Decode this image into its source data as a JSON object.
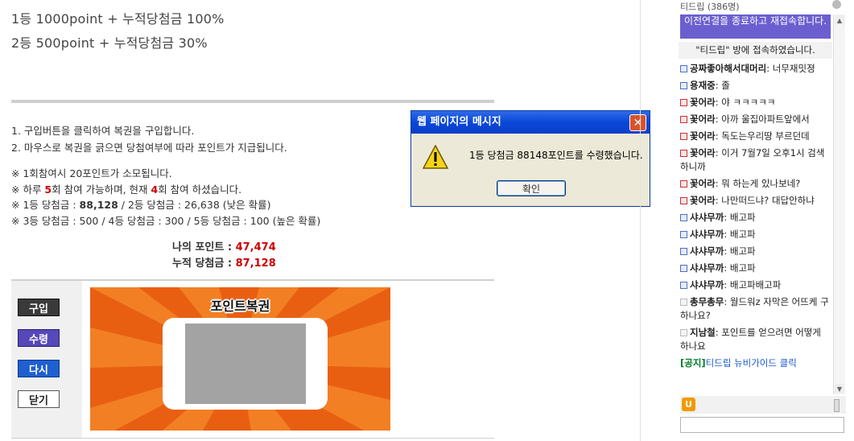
{
  "prizes": {
    "first": "1등  1000point + 누적당첨금 100%",
    "second": "2등  500point + 누적당첨금 30%"
  },
  "instructions": [
    "1. 구입버튼을 클릭하여 복권을 구입합니다.",
    "2. 마우스로 복권을 긁으면 당첨여부에 따라 포인트가 지급됩니다."
  ],
  "rules": {
    "cost": "※ 1회참여시 20포인트가 소모됩니다.",
    "limit_pre": "※ 하루 ",
    "limit_count": "5",
    "limit_mid": "회 참여 가능하며, 현재 ",
    "limit_current": "4",
    "limit_post": "회 참여 하셨습니다.",
    "r1_label": "※ 1등 당첨금 : ",
    "r1_value": "88,128",
    "r1_rest": " / 2등 당첨금 : 26,638 (낮은 확률)",
    "r2": "※ 3등 당첨금 : 500 / 4등 당첨금 : 300 / 5등 당첨금 : 100 (높은 확률)"
  },
  "points": {
    "my_label": "나의 포인트 : ",
    "my_value": "47,474",
    "acc_label": "누적 당첨금 : ",
    "acc_value": "87,128"
  },
  "buttons": {
    "buy": "구입",
    "receive": "수령",
    "again": "다시",
    "close": "닫기"
  },
  "lottery": {
    "title": "포인트복권"
  },
  "dialog": {
    "title": "웹 페이지의 메시지",
    "message": "1등 당첨금 88148포인트를 수령했습니다.",
    "ok": "확인",
    "icon": "warning-icon"
  },
  "chat": {
    "header": "티드립 (386명)",
    "reconnect": "이전연결을 종료하고 재접속합니다.",
    "system": "\"티드립\" 방에 접속하였습니다.",
    "messages": [
      {
        "nick": "공짜좋아해서대머리",
        "text": ": 너무재밋졍",
        "icon": "blue"
      },
      {
        "nick": "용재중",
        "text": ": 졸",
        "icon": "blue"
      },
      {
        "nick": "꽃어라",
        "text": ": 야 ㅋㅋㅋㅋㅋ",
        "icon": "red"
      },
      {
        "nick": "꽃어라",
        "text": ": 아까 울집아파트앞에서",
        "icon": "red"
      },
      {
        "nick": "꽃어라",
        "text": ": 독도는우리땅 부르던데",
        "icon": "red"
      },
      {
        "nick": "꽃어라",
        "text": ": 이거 7월7일 오후1시 검색하니까",
        "icon": "red"
      },
      {
        "nick": "꽃어라",
        "text": ": 뭐 하는게 있나보네?",
        "icon": "red"
      },
      {
        "nick": "꽃어라",
        "text": ": 나만떠드냐? 대답안하냐",
        "icon": "red"
      },
      {
        "nick": "샤샤무까",
        "text": ": 배고파",
        "icon": "blue"
      },
      {
        "nick": "샤샤무까",
        "text": ": 배고파",
        "icon": "blue"
      },
      {
        "nick": "샤샤무까",
        "text": ": 배고파",
        "icon": "blue"
      },
      {
        "nick": "샤샤무까",
        "text": ": 배고파",
        "icon": "blue"
      },
      {
        "nick": "샤샤무까",
        "text": ": 배고파배고파",
        "icon": "blue"
      },
      {
        "nick": "총무총무",
        "text": ": 월드워z 자막은 어뜨케 구하나요?",
        "icon": "grey"
      },
      {
        "nick": "지남철",
        "text": ": 포인트를 얻으려면 어떻게 하나요",
        "icon": "grey"
      }
    ],
    "notice_tag": "[공지]",
    "notice_text": "티드립 뉴비가이드 클릭",
    "input_value": ""
  }
}
